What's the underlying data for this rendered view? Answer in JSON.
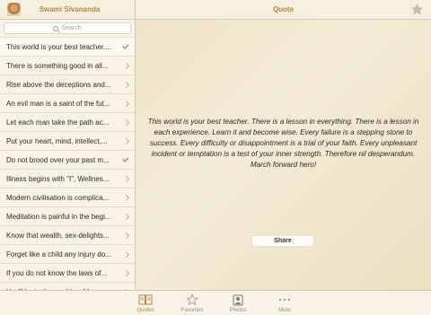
{
  "sidebar": {
    "title": "Swami Sivananda",
    "search_placeholder": "Search",
    "items": [
      {
        "label": "This world is your best teacher....",
        "accessory": "check"
      },
      {
        "label": "There is something good in all...",
        "accessory": "chevron"
      },
      {
        "label": "Rise above the deceptions and...",
        "accessory": "chevron"
      },
      {
        "label": "An evil man is a saint of the fut...",
        "accessory": "chevron"
      },
      {
        "label": "Let each man take the path ac...",
        "accessory": "chevron"
      },
      {
        "label": "Put your heart, mind, intellect,...",
        "accessory": "chevron"
      },
      {
        "label": "Do not brood over your past m...",
        "accessory": "check"
      },
      {
        "label": "Illness begins with \"I\", Wellnes...",
        "accessory": "chevron"
      },
      {
        "label": "Modern civilisation is complica...",
        "accessory": "chevron"
      },
      {
        "label": "Meditation is painful in the begi...",
        "accessory": "chevron"
      },
      {
        "label": "Know that wealth, sex-delights...",
        "accessory": "chevron"
      },
      {
        "label": "Forget like a child any injury do...",
        "accessory": "chevron"
      },
      {
        "label": "If you do not know the laws of...",
        "accessory": "chevron"
      },
      {
        "label": "You'll be in the world so M...",
        "accessory": "chevron"
      }
    ]
  },
  "main": {
    "title": "Quote",
    "quote": "This world is your best teacher. There is a lesson in everything. There is a lesson in each experience. Learn it and become wise. Every failure is a stepping stone to success. Every difficulty or disappointment is a trial of your faith. Every unpleasant incident or temptation is a test of your inner strength. Therefore nil desperandum. March forward hero!",
    "share_label": "Share"
  },
  "tabbar": {
    "tabs": [
      {
        "label": "Quotes",
        "icon": "book-icon",
        "active": true
      },
      {
        "label": "Favorites",
        "icon": "star-icon",
        "active": false
      },
      {
        "label": "Photos",
        "icon": "photos-icon",
        "active": false
      },
      {
        "label": "More",
        "icon": "more-icon",
        "active": false
      }
    ]
  },
  "colors": {
    "accent": "#b08a3c",
    "background": "#f0e6cf",
    "check": "#6a7d52"
  }
}
